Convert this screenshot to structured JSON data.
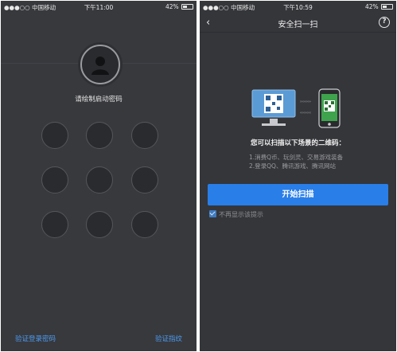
{
  "left_screen": {
    "status": {
      "carrier": "●●●○○ 中国移动",
      "time": "下午11:00",
      "battery_text": "42%",
      "battery_level": 0.42
    },
    "draw_hint": "请绘制启动密码",
    "pattern_dots": 9,
    "footer": {
      "verify_login_password": "验证登录密码",
      "verify_fingerprint": "验证指纹"
    },
    "colors": {
      "link": "#4b9bf2",
      "background": "#38393d"
    }
  },
  "right_screen": {
    "status": {
      "carrier": "●●●○○ 中国移动",
      "time": "下午10:59",
      "battery_text": "42%",
      "battery_level": 0.42
    },
    "nav": {
      "back_icon": "chevron-left-icon",
      "title": "安全扫一扫",
      "help_label": "?"
    },
    "scan_title": "您可以扫描以下场景的二维码：",
    "scan_lines": [
      "1.消费Q币、玩剑灵、交易游戏装备",
      "2.登录QQ、腾讯游戏、腾讯网站"
    ],
    "start_button": "开始扫描",
    "dont_show_again": "不再显示该提示",
    "dont_show_checked": true,
    "colors": {
      "accent": "#2a7ee8",
      "qr_pc": "#5b9bd5",
      "qr_phone": "#3fa34d"
    }
  }
}
